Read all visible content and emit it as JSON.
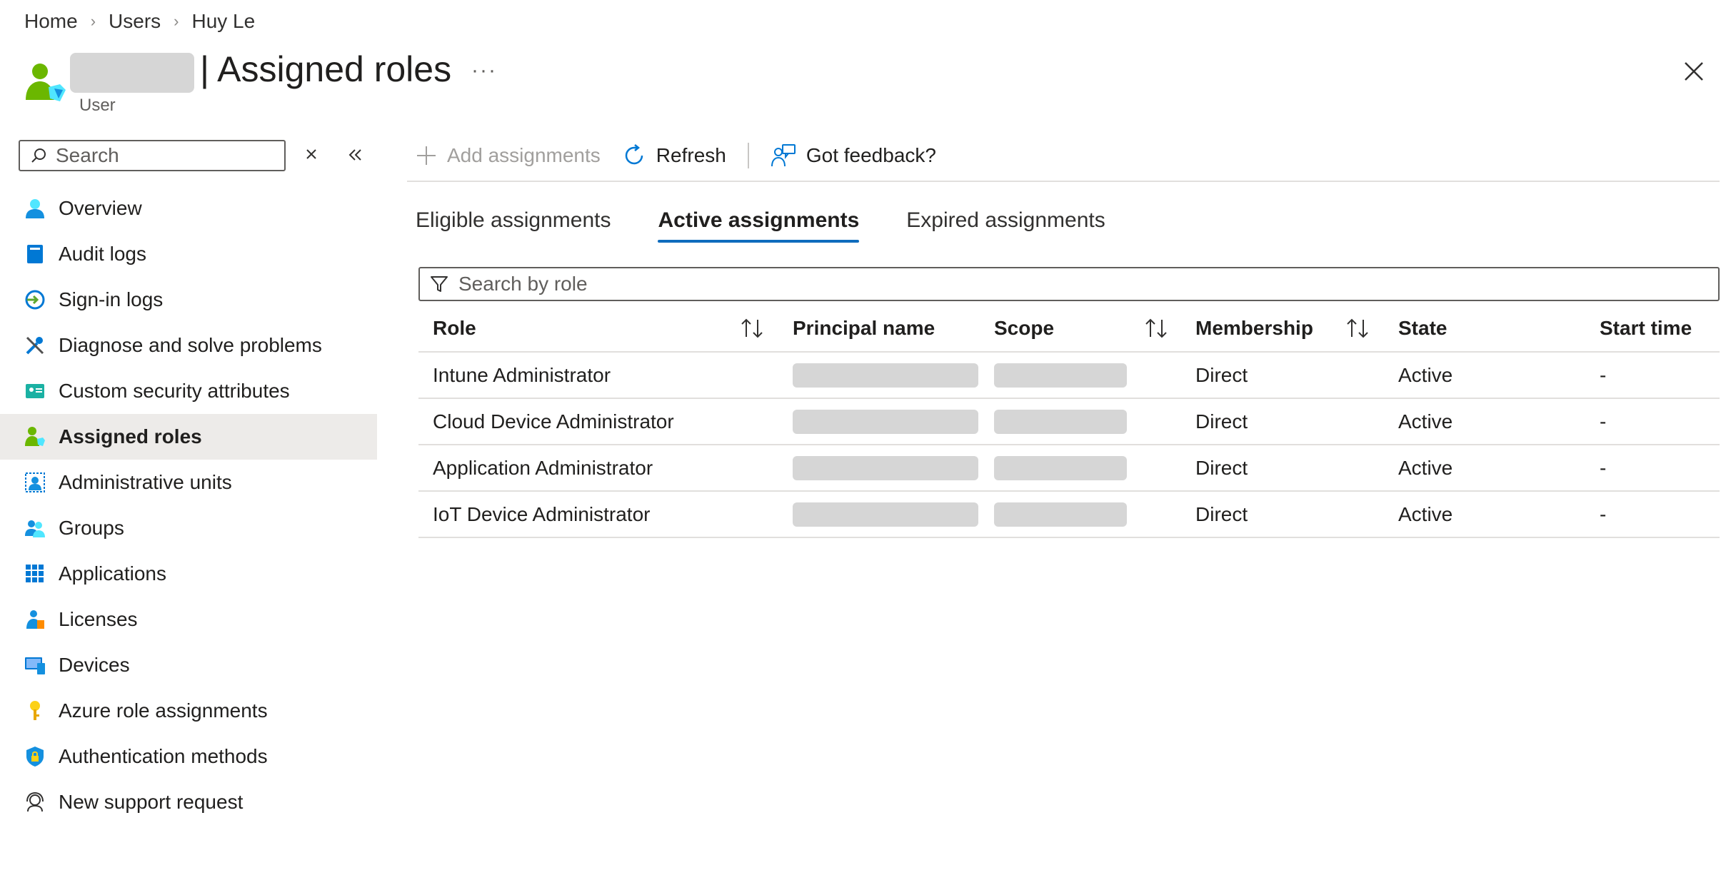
{
  "breadcrumb": {
    "items": [
      "Home",
      "Users",
      "Huy Le"
    ]
  },
  "header": {
    "title": "| Assigned roles",
    "subtitle": "User",
    "more_label": "···"
  },
  "sidebar": {
    "search_placeholder": "Search",
    "items": [
      {
        "label": "Overview",
        "icon": "user-overview-icon",
        "active": false
      },
      {
        "label": "Audit logs",
        "icon": "audit-log-icon",
        "active": false
      },
      {
        "label": "Sign-in logs",
        "icon": "sign-in-icon",
        "active": false
      },
      {
        "label": "Diagnose and solve problems",
        "icon": "wrench-icon",
        "active": false
      },
      {
        "label": "Custom security attributes",
        "icon": "security-attributes-icon",
        "active": false
      },
      {
        "label": "Assigned roles",
        "icon": "assigned-roles-icon",
        "active": true
      },
      {
        "label": "Administrative units",
        "icon": "admin-units-icon",
        "active": false
      },
      {
        "label": "Groups",
        "icon": "groups-icon",
        "active": false
      },
      {
        "label": "Applications",
        "icon": "applications-grid-icon",
        "active": false
      },
      {
        "label": "Licenses",
        "icon": "licenses-icon",
        "active": false
      },
      {
        "label": "Devices",
        "icon": "devices-icon",
        "active": false
      },
      {
        "label": "Azure role assignments",
        "icon": "key-icon",
        "active": false
      },
      {
        "label": "Authentication methods",
        "icon": "shield-lock-icon",
        "active": false
      },
      {
        "label": "New support request",
        "icon": "support-icon",
        "active": false
      }
    ]
  },
  "toolbar": {
    "add_label": "Add assignments",
    "refresh_label": "Refresh",
    "feedback_label": "Got feedback?"
  },
  "tabs": [
    {
      "label": "Eligible assignments",
      "active": false
    },
    {
      "label": "Active assignments",
      "active": true
    },
    {
      "label": "Expired assignments",
      "active": false
    }
  ],
  "filter": {
    "placeholder": "Search by role"
  },
  "table": {
    "columns": [
      "Role",
      "Principal name",
      "Scope",
      "Membership",
      "State",
      "Start time"
    ],
    "rows": [
      {
        "role": "Intune Administrator",
        "membership": "Direct",
        "state": "Active",
        "start_time": "-"
      },
      {
        "role": "Cloud Device Administrator",
        "membership": "Direct",
        "state": "Active",
        "start_time": "-"
      },
      {
        "role": "Application Administrator",
        "membership": "Direct",
        "state": "Active",
        "start_time": "-"
      },
      {
        "role": "IoT Device Administrator",
        "membership": "Direct",
        "state": "Active",
        "start_time": "-"
      }
    ]
  },
  "colors": {
    "accent": "#0f6cbd",
    "selected_bg": "#edebe9",
    "border": "#605e5c",
    "redaction": "#d6d6d6"
  }
}
